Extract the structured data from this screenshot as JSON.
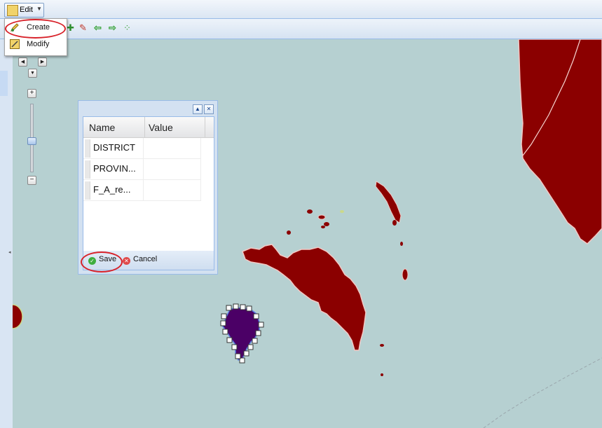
{
  "toolbar": {
    "edit_label": "Edit",
    "edit_icon": "edit-icon",
    "dropdown_icon": "chevron-down-icon"
  },
  "edit_menu": {
    "items": [
      {
        "label": "Create",
        "icon": "create-pencil-icon",
        "highlighted": true
      },
      {
        "label": "Modify",
        "icon": "modify-icon"
      }
    ]
  },
  "map_toolbar": {
    "icons": [
      "zoom-in-icon",
      "zoom-out-icon",
      "back-arrow-icon",
      "forward-arrow-icon",
      "zoom-extent-icon"
    ]
  },
  "attribute_panel": {
    "columns": [
      "Name",
      "Value"
    ],
    "rows": [
      {
        "name": "DISTRICT",
        "value": ""
      },
      {
        "name": "PROVIN...",
        "value": ""
      },
      {
        "name": "F_A_re...",
        "value": ""
      }
    ],
    "save_label": "Save",
    "cancel_label": "Cancel"
  },
  "colors": {
    "map_water": "#b6d0d1",
    "land_fill": "#8b0000",
    "selected_feature": "#4b0066",
    "highlight_ring": "#d8222a"
  }
}
